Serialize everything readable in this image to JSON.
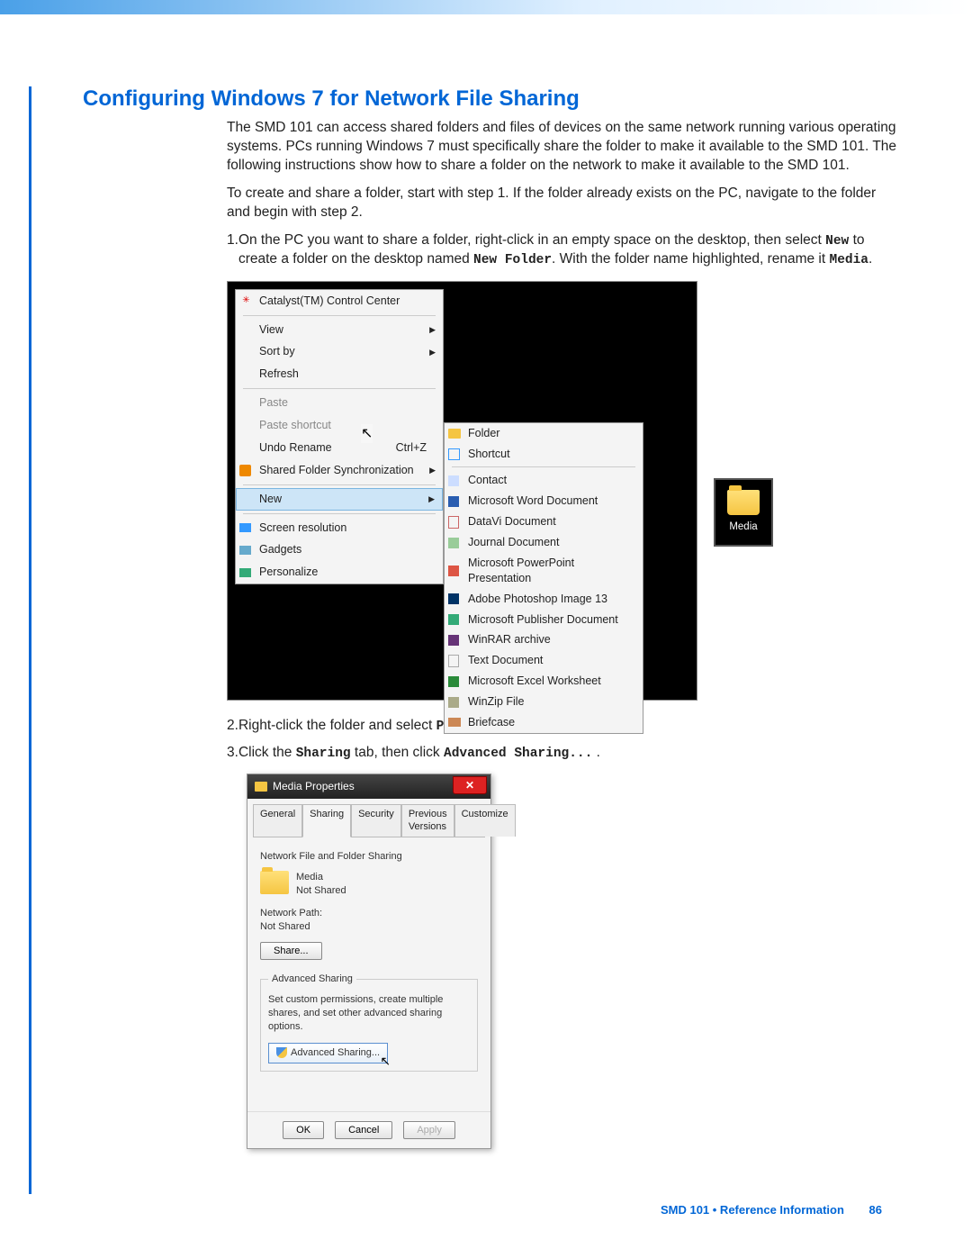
{
  "title": "Configuring Windows 7 for Network File Sharing",
  "para1": "The SMD 101 can access shared folders and files of devices on the same network running various operating systems. PCs running Windows 7 must specifically share the folder to make it available to the SMD 101. The following instructions show how to share a folder on the network to make it available to the SMD 101.",
  "para2": "To create and share a folder, start with step 1. If the folder already exists on the PC, navigate to the folder and begin with step 2.",
  "step1_a": "On the PC you want to share a folder, right-click in an empty space on the desktop, then select ",
  "step1_new": "New",
  "step1_b": " to create a folder on the desktop named ",
  "step1_newfolder": "New Folder",
  "step1_c": ". With the folder name highlighted, rename it ",
  "step1_media": "Media",
  "step1_d": ".",
  "context_menu": {
    "catalyst": "Catalyst(TM) Control Center",
    "view": "View",
    "sortby": "Sort by",
    "refresh": "Refresh",
    "paste": "Paste",
    "paste_shortcut": "Paste shortcut",
    "undo_rename": "Undo Rename",
    "undo_shortcut": "Ctrl+Z",
    "shared_sync": "Shared Folder Synchronization",
    "new": "New",
    "screen_res": "Screen resolution",
    "gadgets": "Gadgets",
    "personalize": "Personalize"
  },
  "submenu": {
    "folder": "Folder",
    "shortcut": "Shortcut",
    "contact": "Contact",
    "word": "Microsoft Word Document",
    "datavi": "DataVi Document",
    "journal": "Journal Document",
    "ppt": "Microsoft PowerPoint Presentation",
    "psd": "Adobe Photoshop Image 13",
    "publisher": "Microsoft Publisher Document",
    "winrar": "WinRAR archive",
    "text": "Text Document",
    "excel": "Microsoft Excel Worksheet",
    "winzip": "WinZip File",
    "briefcase": "Briefcase"
  },
  "desktop_icon_label": "Media",
  "step2_a": "Right-click the folder and select ",
  "step2_props": "Properties",
  "step2_b": ".",
  "step3_a": "Click the ",
  "step3_sharing": "Sharing",
  "step3_b": " tab, then click ",
  "step3_adv": "Advanced Sharing...",
  "step3_c": " .",
  "props": {
    "title": "Media Properties",
    "tabs": [
      "General",
      "Sharing",
      "Security",
      "Previous Versions",
      "Customize"
    ],
    "section_title": "Network File and Folder Sharing",
    "folder_name": "Media",
    "shared_status": "Not Shared",
    "network_path_label": "Network Path:",
    "network_path_value": "Not Shared",
    "share_btn": "Share...",
    "adv_legend": "Advanced Sharing",
    "adv_desc": "Set custom permissions, create multiple shares, and set other advanced sharing options.",
    "adv_btn": "Advanced Sharing...",
    "ok": "OK",
    "cancel": "Cancel",
    "apply": "Apply"
  },
  "footer_text": "SMD 101 • Reference Information",
  "page_number": "86"
}
